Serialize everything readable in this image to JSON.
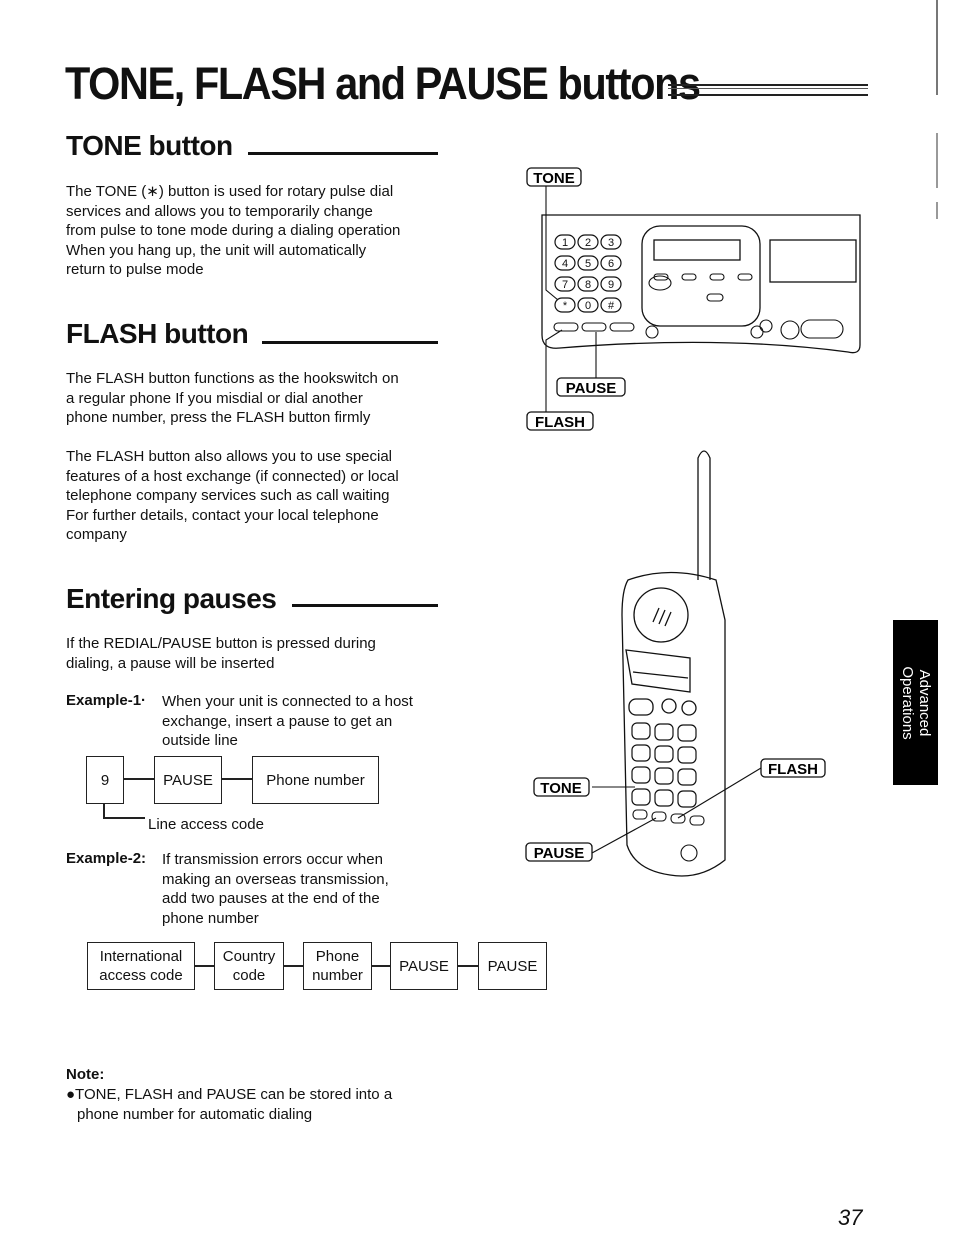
{
  "page": {
    "title": "TONE, FLASH and PAUSE buttons",
    "page_number": "37",
    "side_tab": [
      "Advanced",
      "Operations"
    ]
  },
  "tone_section": {
    "heading": "TONE button",
    "lines": [
      "The TONE (∗) button is used for rotary pulse dial",
      "services and allows you to temporarily change",
      "from pulse to tone mode during a dialing operation",
      "When you hang up, the unit will automatically",
      "return to pulse mode"
    ]
  },
  "flash_section": {
    "heading": "FLASH button",
    "para1": [
      "The FLASH button functions as the hookswitch on",
      "a regular phone  If you misdial or dial another",
      "phone number, press the FLASH button firmly"
    ],
    "para2": [
      "The FLASH button also allows you to use special",
      "features of a host exchange (if connected) or local",
      "telephone company services such as call waiting",
      "For further details, contact your local telephone",
      "company"
    ]
  },
  "pause_section": {
    "heading": "Entering pauses",
    "intro": [
      "If the REDIAL/PAUSE button is pressed during",
      "dialing, a pause will be inserted"
    ],
    "example1": {
      "label": "Example-1·",
      "text": [
        "When your unit is connected to a host",
        "exchange, insert a pause to get an",
        "outside line"
      ],
      "boxes": [
        "9",
        "PAUSE",
        "Phone number"
      ],
      "callout": "Line access code"
    },
    "example2": {
      "label": "Example-2:",
      "text": [
        "If transmission errors occur when",
        "making an overseas transmission,",
        "add two pauses at the end of the",
        "phone number"
      ],
      "boxes": [
        [
          "International",
          "access code"
        ],
        [
          "Country",
          "code"
        ],
        [
          "Phone",
          "number"
        ],
        [
          "PAUSE"
        ],
        [
          "PAUSE"
        ]
      ]
    }
  },
  "note": {
    "heading": "Note:",
    "lines": [
      "●TONE, FLASH and PAUSE can be stored into a",
      "phone number for automatic dialing"
    ]
  },
  "illustrations": {
    "base_unit": {
      "labels": {
        "tone": "TONE",
        "pause": "PAUSE",
        "flash": "FLASH"
      },
      "keypad": [
        "1",
        "2",
        "3",
        "4",
        "5",
        "6",
        "7",
        "8",
        "9",
        "*",
        "0",
        "#"
      ]
    },
    "handset": {
      "labels": {
        "tone": "TONE",
        "pause": "PAUSE",
        "flash": "FLASH"
      }
    }
  }
}
